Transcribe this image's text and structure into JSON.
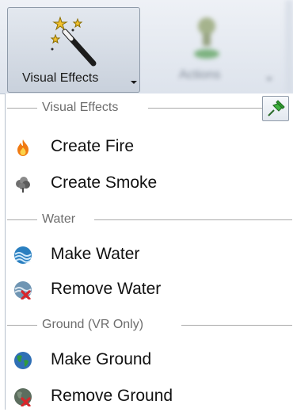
{
  "ribbon": {
    "active_button": {
      "label": "Visual Effects",
      "icon": "magic-wand-icon"
    },
    "secondary_button": {
      "label": "Actions",
      "icon": "actor-icon"
    }
  },
  "menu": {
    "pin_icon": "pin-icon",
    "sections": [
      {
        "title": "Visual Effects",
        "items": [
          {
            "label": "Create Fire",
            "icon": "fire-icon"
          },
          {
            "label": "Create Smoke",
            "icon": "smoke-icon"
          }
        ]
      },
      {
        "title": "Water",
        "items": [
          {
            "label": "Make Water",
            "icon": "water-icon"
          },
          {
            "label": "Remove Water",
            "icon": "remove-water-icon"
          }
        ]
      },
      {
        "title": "Ground (VR Only)",
        "items": [
          {
            "label": "Make Ground",
            "icon": "globe-icon"
          },
          {
            "label": "Remove Ground",
            "icon": "remove-ground-icon"
          }
        ]
      }
    ]
  },
  "colors": {
    "ribbon_bg": "#dde3ec",
    "separator": "#a9a9a9",
    "section_title": "#6d6d6d",
    "pin_green": "#2e9b2e",
    "fire_orange": "#f07a12",
    "water_blue": "#2a7fc0",
    "remove_red": "#d8262b"
  }
}
